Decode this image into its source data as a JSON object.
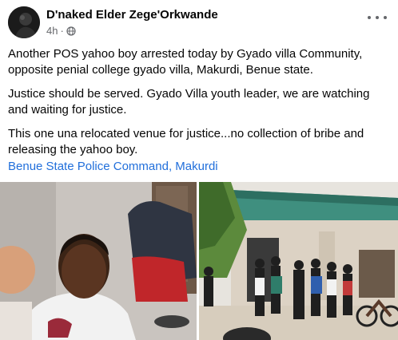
{
  "post": {
    "author": "D'naked Elder Zege'Orkwande",
    "time": "4h",
    "privacy_icon": "globe-icon",
    "paragraphs": [
      "Another POS yahoo boy arrested today by Gyado villa Community, opposite penial college gyado villa, Makurdi, Benue state.",
      "Justice should be served. Gyado Villa youth leader, we are watching and waiting for justice.",
      "This one una relocated venue for justice...no collection of bribe and releasing the yahoo boy."
    ],
    "link": "Benue State Police Command, Makurdi"
  },
  "colors": {
    "text": "#050505",
    "secondary": "#65676b",
    "link": "#216fdb"
  }
}
